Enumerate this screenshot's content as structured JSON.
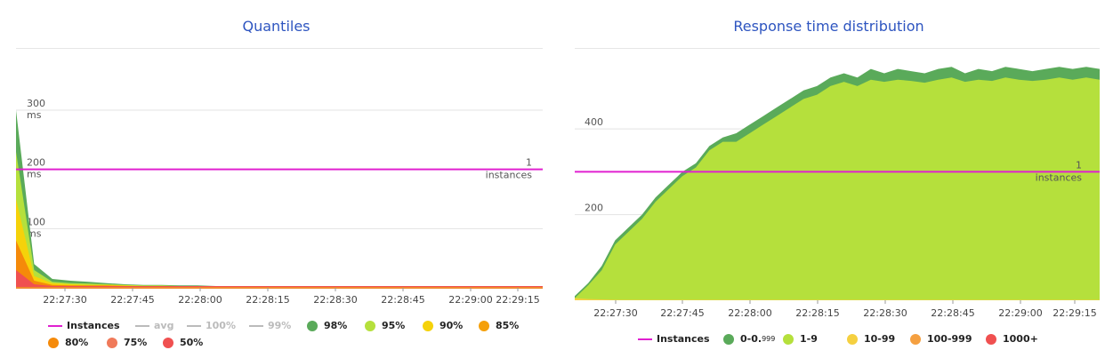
{
  "charts": [
    {
      "title": "Quantiles",
      "type": "area",
      "x_ticks": [
        "22:27:30",
        "22:27:45",
        "22:28:00",
        "22:28:15",
        "22:28:30",
        "22:28:45",
        "22:29:00",
        "22:29:15"
      ],
      "y_ticks": [
        {
          "value": "300",
          "unit": "ms"
        },
        {
          "value": "200",
          "unit": "ms"
        },
        {
          "value": "100",
          "unit": "ms"
        }
      ],
      "instances_label": {
        "value": "1",
        "unit": "instances"
      },
      "legend": [
        {
          "label": "Instances",
          "color": "#e020d0",
          "kind": "line",
          "enabled": true
        },
        {
          "label": "avg",
          "color": "#bbbbbb",
          "kind": "line",
          "enabled": false
        },
        {
          "label": "100%",
          "color": "#bbbbbb",
          "kind": "line",
          "enabled": false
        },
        {
          "label": "99%",
          "color": "#bbbbbb",
          "kind": "line",
          "enabled": false
        },
        {
          "label": "98%",
          "color": "#5aaa5a",
          "kind": "dot",
          "enabled": true
        },
        {
          "label": "95%",
          "color": "#b5e03c",
          "kind": "dot",
          "enabled": true
        },
        {
          "label": "90%",
          "color": "#f5d20a",
          "kind": "dot",
          "enabled": true
        },
        {
          "label": "85%",
          "color": "#f5a00a",
          "kind": "dot",
          "enabled": true
        },
        {
          "label": "80%",
          "color": "#f58a0a",
          "kind": "dot",
          "enabled": true
        },
        {
          "label": "75%",
          "color": "#f07a5a",
          "kind": "dot",
          "enabled": true
        },
        {
          "label": "50%",
          "color": "#f05050",
          "kind": "dot",
          "enabled": true
        }
      ]
    },
    {
      "title": "Response time distribution",
      "type": "area",
      "x_ticks": [
        "22:27:30",
        "22:27:45",
        "22:28:00",
        "22:28:15",
        "22:28:30",
        "22:28:45",
        "22:29:00",
        "22:29:15"
      ],
      "y_ticks": [
        {
          "value": "400",
          "unit": ""
        },
        {
          "value": "200",
          "unit": ""
        }
      ],
      "instances_label": {
        "value": "1",
        "unit": "instances"
      },
      "legend": [
        {
          "label": "Instances",
          "color": "#e020d0",
          "kind": "line",
          "enabled": true
        },
        {
          "label": "0-0.",
          "sub": "999",
          "color": "#5aaa5a",
          "kind": "dot",
          "enabled": true
        },
        {
          "label": "1-9",
          "color": "#b5e03c",
          "kind": "dot",
          "enabled": true
        },
        {
          "label": "10-99",
          "color": "#f5d040",
          "kind": "dot",
          "enabled": true
        },
        {
          "label": "100-999",
          "color": "#f5a040",
          "kind": "dot",
          "enabled": true
        },
        {
          "label": "1000+",
          "color": "#f05050",
          "kind": "dot",
          "enabled": true
        }
      ]
    }
  ],
  "chart_data": [
    {
      "type": "area",
      "title": "Quantiles",
      "ylabel": "ms",
      "ylim": [
        0,
        300
      ],
      "x_start": "22:27:22",
      "x_end": "22:29:20",
      "instances": 1,
      "instances_y": 200,
      "series": [
        {
          "name": "98%",
          "color": "#5aaa5a",
          "values": [
            300,
            40,
            15,
            12,
            10,
            8,
            6,
            5,
            5,
            4,
            4,
            3,
            3,
            3,
            3,
            3,
            3,
            3,
            3,
            3,
            3,
            3,
            3,
            3,
            3,
            3,
            3,
            3,
            3,
            3
          ]
        },
        {
          "name": "95%",
          "color": "#b5e03c",
          "values": [
            230,
            30,
            10,
            8,
            7,
            6,
            5,
            4,
            4,
            3,
            3,
            3,
            3,
            3,
            3,
            3,
            3,
            3,
            3,
            3,
            3,
            3,
            3,
            3,
            3,
            3,
            3,
            3,
            3,
            3
          ]
        },
        {
          "name": "90%",
          "color": "#f5d20a",
          "values": [
            150,
            20,
            8,
            6,
            5,
            5,
            4,
            3,
            3,
            3,
            3,
            3,
            3,
            3,
            3,
            3,
            3,
            3,
            3,
            3,
            3,
            3,
            3,
            3,
            3,
            3,
            3,
            3,
            3,
            3
          ]
        },
        {
          "name": "80%",
          "color": "#f58a0a",
          "values": [
            80,
            12,
            5,
            4,
            4,
            4,
            3,
            3,
            3,
            3,
            3,
            3,
            3,
            3,
            3,
            3,
            3,
            3,
            3,
            3,
            3,
            3,
            3,
            3,
            3,
            3,
            3,
            3,
            3,
            3
          ]
        },
        {
          "name": "50%",
          "color": "#f05050",
          "values": [
            30,
            6,
            3,
            3,
            3,
            3,
            3,
            3,
            3,
            3,
            3,
            3,
            3,
            3,
            3,
            3,
            3,
            3,
            3,
            3,
            3,
            3,
            3,
            3,
            3,
            3,
            3,
            3,
            3,
            3
          ]
        }
      ]
    },
    {
      "type": "area",
      "title": "Response time distribution",
      "ylim": [
        0,
        560
      ],
      "x_start": "22:27:22",
      "x_end": "22:29:20",
      "instances": 1,
      "instances_y": 300,
      "series": [
        {
          "name": "0-0.999",
          "color": "#5aaa5a",
          "stacked_top": [
            10,
            40,
            80,
            140,
            170,
            200,
            240,
            270,
            300,
            320,
            360,
            380,
            390,
            410,
            430,
            450,
            470,
            490,
            500,
            520,
            530,
            520,
            540,
            530,
            540,
            535,
            530,
            540,
            545,
            530,
            540,
            535,
            545,
            540,
            535,
            540,
            545,
            540,
            545,
            540
          ]
        },
        {
          "name": "1-9",
          "color": "#b5e03c",
          "values": [
            5,
            35,
            70,
            130,
            160,
            190,
            230,
            260,
            290,
            310,
            350,
            370,
            370,
            390,
            410,
            430,
            450,
            470,
            480,
            500,
            510,
            500,
            515,
            510,
            515,
            512,
            508,
            515,
            520,
            510,
            515,
            512,
            520,
            515,
            512,
            515,
            520,
            515,
            520,
            515
          ]
        },
        {
          "name": "10-99",
          "color": "#f5d040",
          "values": [
            5,
            3,
            2,
            1,
            1,
            1,
            1,
            1,
            1,
            1,
            1,
            1,
            1,
            1,
            1,
            1,
            1,
            1,
            1,
            1,
            1,
            1,
            1,
            1,
            1,
            1,
            1,
            1,
            1,
            1,
            1,
            1,
            1,
            1,
            1,
            1,
            1,
            1,
            1,
            1
          ]
        }
      ]
    }
  ]
}
